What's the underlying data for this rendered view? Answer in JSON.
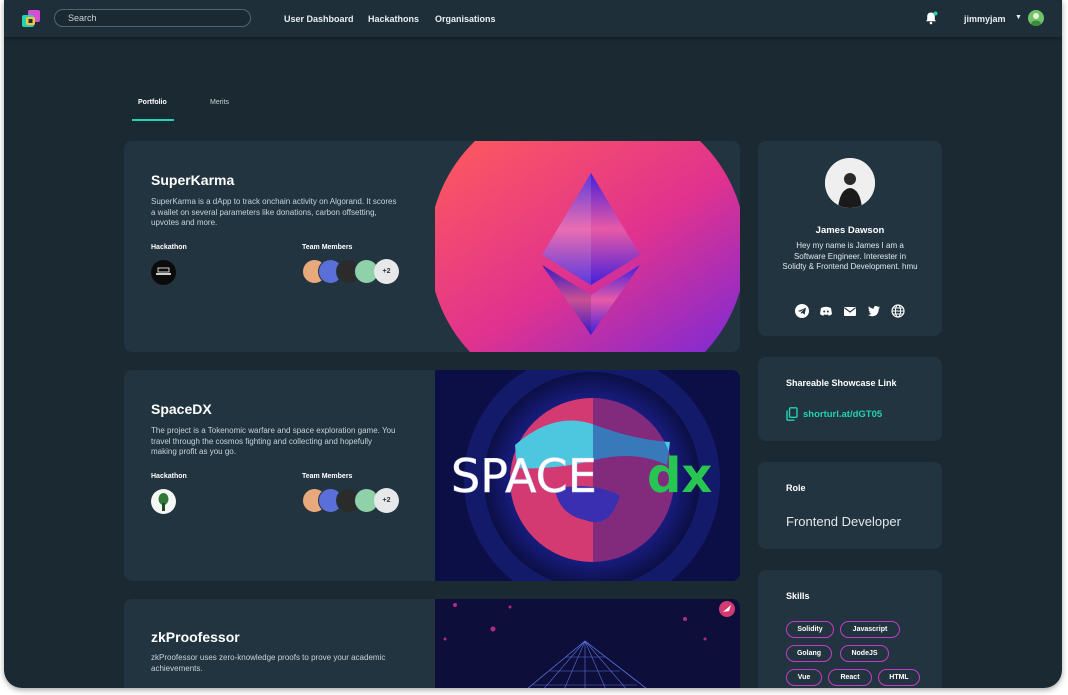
{
  "nav": {
    "search_placeholder": "Search",
    "links": [
      "User Dashboard",
      "Hackathons",
      "Organisations"
    ],
    "username": "jimmyjam"
  },
  "tabs": [
    "Portfolio",
    "Merits"
  ],
  "projects": [
    {
      "title": "SuperKarma",
      "description": "SuperKarma is a dApp to track onchain activity on Algorand. It scores a wallet on several parameters like donations, carbon offsetting, upvotes and more.",
      "hackathon_label": "Hackathon",
      "team_label": "Team Members",
      "extra_members": "+2"
    },
    {
      "title": "SpaceDX",
      "description": "The project is a Tokenomic warfare and space exploration game. You travel through the cosmos fighting and collecting and hopefully making profit as you go.",
      "hackathon_label": "Hackathon",
      "team_label": "Team Members",
      "extra_members": "+2",
      "art_text_left": "SPACE",
      "art_text_right": "dx"
    },
    {
      "title": "zkProofessor",
      "description": "zkProofessor uses zero-knowledge proofs to prove your academic achievements."
    }
  ],
  "profile": {
    "name": "James Dawson",
    "bio": "Hey my name is James I am a Software Engineer. Interester in Solidty & Frontend Development. hmu",
    "socials": [
      "telegram-icon",
      "discord-icon",
      "mail-icon",
      "twitter-icon",
      "globe-icon"
    ]
  },
  "showcase": {
    "heading": "Shareable Showcase Link",
    "link": "shorturl.at/dGT05"
  },
  "role": {
    "heading": "Role",
    "value": "Frontend Developer"
  },
  "skills": {
    "heading": "Skills",
    "items": [
      "Solidity",
      "Javascript",
      "Golang",
      "NodeJS",
      "Vue",
      "React",
      "HTML"
    ]
  },
  "colors": {
    "accent": "#22d3b0",
    "chip_border": "#c53bc9",
    "background": "#1b2932",
    "card": "#223440"
  }
}
